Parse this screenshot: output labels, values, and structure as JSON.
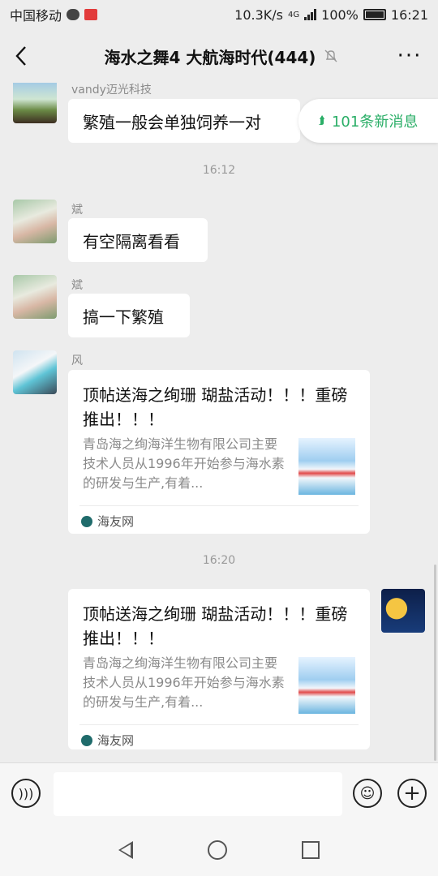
{
  "status_bar": {
    "carrier": "中国移动",
    "speed": "10.3K/s",
    "network": "4G",
    "battery": "100%",
    "time": "16:21"
  },
  "header": {
    "title": "海水之舞4 大航海时代(444)",
    "back_icon": "chevron-left-icon",
    "mute_icon": "bell-off-icon",
    "more_label": "···"
  },
  "new_messages": {
    "label": "101条新消息",
    "icon": "double-chevron-up-icon",
    "color": "#2aae67"
  },
  "messages": [
    {
      "sender": "vandy迈光科技",
      "text": "繁殖一般会单独饲养一对"
    },
    {
      "time": "16:12"
    },
    {
      "sender": "斌",
      "text": "有空隔离看看"
    },
    {
      "sender": "斌",
      "text": "搞一下繁殖"
    },
    {
      "sender": "风",
      "card": {
        "title": "顶帖送海之绚珊 瑚盐活动！！！重磅推出！！！",
        "description": "青岛海之绚海洋生物有限公司主要技术人员从1996年开始参与海水素的研发与生产,有着...",
        "source": "海友网"
      }
    },
    {
      "time": "16:20"
    },
    {
      "self": true,
      "card": {
        "title": "顶帖送海之绚珊 瑚盐活动！！！重磅推出！！！",
        "description": "青岛海之绚海洋生物有限公司主要技术人员从1996年开始参与海水素的研发与生产,有着...",
        "source": "海友网"
      }
    }
  ],
  "input_bar": {
    "voice_icon": "voice-icon",
    "text_value": "",
    "emoji_icon": "emoji-icon",
    "plus_icon": "plus-icon"
  },
  "system_nav": {
    "back": "triangle-back-icon",
    "home": "circle-home-icon",
    "recent": "square-recent-icon"
  }
}
